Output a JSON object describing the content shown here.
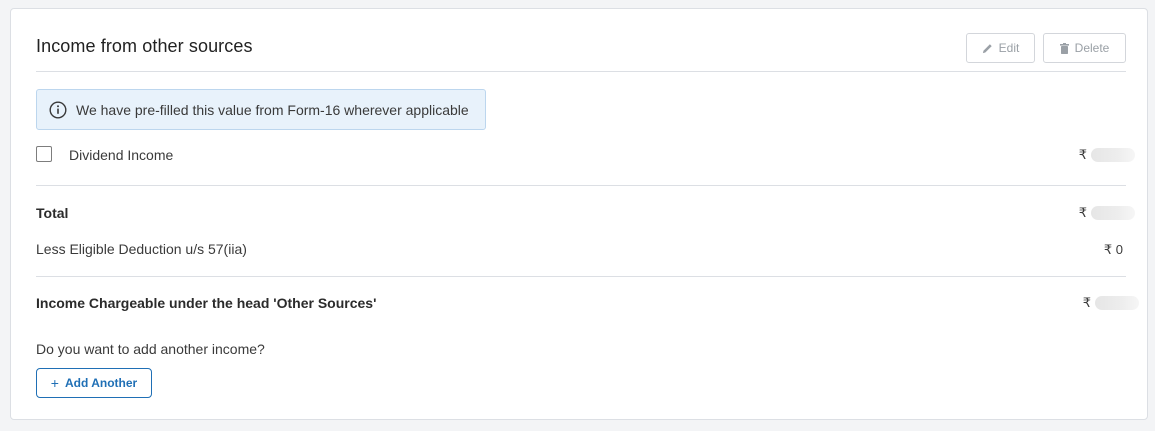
{
  "card": {
    "title": "Income from other sources",
    "edit_label": "Edit",
    "delete_label": "Delete"
  },
  "info_banner": {
    "icon": "info-icon",
    "text": "We have pre-filled this value from Form-16 wherever applicable"
  },
  "rows": {
    "dividend": {
      "label": "Dividend Income",
      "currency": "₹",
      "checked": false
    },
    "total": {
      "label": "Total",
      "currency": "₹"
    },
    "deduction": {
      "label": "Less Eligible Deduction u/s 57(iia)",
      "value": "₹ 0"
    },
    "chargeable": {
      "label": "Income Chargeable under the head 'Other Sources'",
      "currency": "₹"
    }
  },
  "add_prompt": "Do you want to add another income?",
  "add_button": {
    "plus": "+",
    "label": "Add Another"
  },
  "colors": {
    "accent": "#1f6fb5",
    "banner_bg": "#e8f2fb",
    "banner_border": "#bcd6ee",
    "border": "#dcdfe4"
  }
}
